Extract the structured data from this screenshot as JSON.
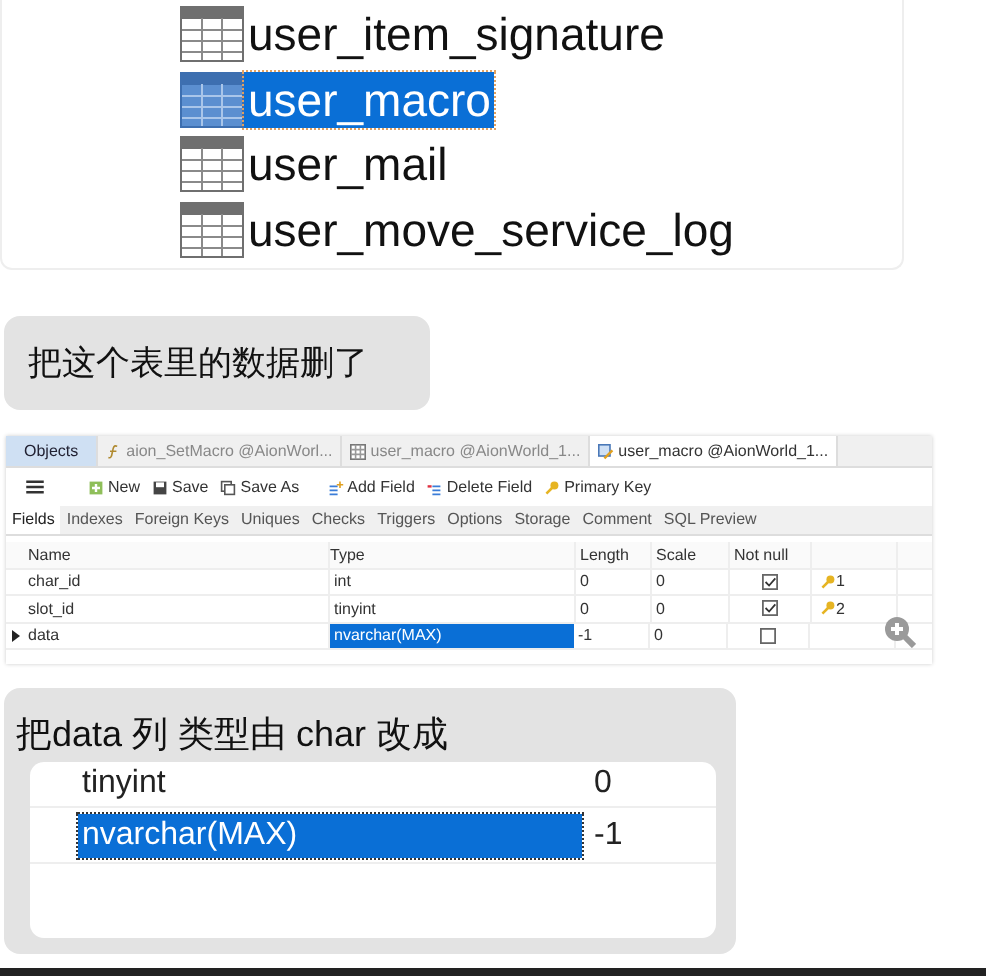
{
  "table_list_image": {
    "items": [
      {
        "name": "user_item_signature",
        "selected": false
      },
      {
        "name": "user_macro",
        "selected": true
      },
      {
        "name": "user_mail",
        "selected": false
      },
      {
        "name": "user_move_service_log",
        "selected": false
      }
    ]
  },
  "message_1": {
    "text": "把这个表里的数据删了"
  },
  "designer_screenshot": {
    "tabs": [
      {
        "kind": "objects",
        "label": "Objects",
        "selected": false
      },
      {
        "kind": "query",
        "label": "aion_SetMacro @AionWorl...",
        "selected": false
      },
      {
        "kind": "table",
        "label": "user_macro @AionWorld_1...",
        "selected": false
      },
      {
        "kind": "design",
        "label": "user_macro @AionWorld_1...",
        "selected": true
      }
    ],
    "toolbar": [
      {
        "kind": "new",
        "label": "New"
      },
      {
        "kind": "save",
        "label": "Save"
      },
      {
        "kind": "saveas",
        "label": "Save As"
      },
      {
        "kind": "addfield",
        "label": "Add Field"
      },
      {
        "kind": "deletefield",
        "label": "Delete Field"
      },
      {
        "kind": "key",
        "label": "Primary Key"
      }
    ],
    "subtabs": [
      {
        "label": "Fields",
        "selected": true
      },
      {
        "label": "Indexes",
        "selected": false
      },
      {
        "label": "Foreign Keys",
        "selected": false
      },
      {
        "label": "Uniques",
        "selected": false
      },
      {
        "label": "Checks",
        "selected": false
      },
      {
        "label": "Triggers",
        "selected": false
      },
      {
        "label": "Options",
        "selected": false
      },
      {
        "label": "Storage",
        "selected": false
      },
      {
        "label": "Comment",
        "selected": false
      },
      {
        "label": "SQL Preview",
        "selected": false
      }
    ],
    "columns": [
      "Name",
      "Type",
      "Length",
      "Scale",
      "Not null"
    ],
    "rows": [
      {
        "name": "char_id",
        "type": "int",
        "length": "0",
        "scale": "0",
        "not_null": true,
        "key": "1",
        "current": false,
        "type_selected": false
      },
      {
        "name": "slot_id",
        "type": "tinyint",
        "length": "0",
        "scale": "0",
        "not_null": true,
        "key": "2",
        "current": false,
        "type_selected": false
      },
      {
        "name": "data",
        "type": "nvarchar(MAX)",
        "length": "-1",
        "scale": "0",
        "not_null": false,
        "current": true,
        "type_selected": true
      }
    ]
  },
  "message_2": {
    "text": "把data 列 类型由 char 改成",
    "image_rows": [
      {
        "type": "tinyint",
        "length": "0",
        "selected": false
      },
      {
        "type": "nvarchar(MAX)",
        "length": "-1",
        "selected": true
      }
    ]
  }
}
